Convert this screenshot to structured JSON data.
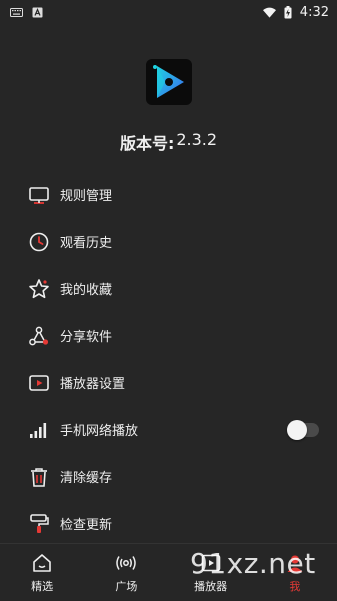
{
  "status_bar": {
    "time": "4:32",
    "icons": [
      "keyboard-icon",
      "text-input-icon",
      "wifi-icon",
      "battery-charging-icon"
    ]
  },
  "app": {
    "logo_icon": "player-logo-icon",
    "version_label": "版本号:",
    "version_value": "2.3.2"
  },
  "menu": {
    "items": [
      {
        "label": "规则管理",
        "icon": "monitor-icon"
      },
      {
        "label": "观看历史",
        "icon": "clock-icon"
      },
      {
        "label": "我的收藏",
        "icon": "star-icon"
      },
      {
        "label": "分享软件",
        "icon": "share-icon"
      },
      {
        "label": "播放器设置",
        "icon": "play-screen-icon"
      },
      {
        "label": "手机网络播放",
        "icon": "signal-icon",
        "toggle": false
      },
      {
        "label": "清除缓存",
        "icon": "trash-icon"
      },
      {
        "label": "检查更新",
        "icon": "paint-roller-icon"
      }
    ]
  },
  "bottom_nav": {
    "items": [
      {
        "label": "精选",
        "icon": "home-icon",
        "active": false
      },
      {
        "label": "广场",
        "icon": "broadcast-icon",
        "active": false
      },
      {
        "label": "播放器",
        "icon": "player-icon",
        "active": false
      },
      {
        "label": "我",
        "icon": "profile-icon",
        "active": true
      }
    ]
  },
  "watermark": "91xz.net",
  "colors": {
    "background": "#262626",
    "accent_red": "#e53935",
    "logo_cyan": "#1fd1e0",
    "logo_blue": "#3b6cf0"
  }
}
